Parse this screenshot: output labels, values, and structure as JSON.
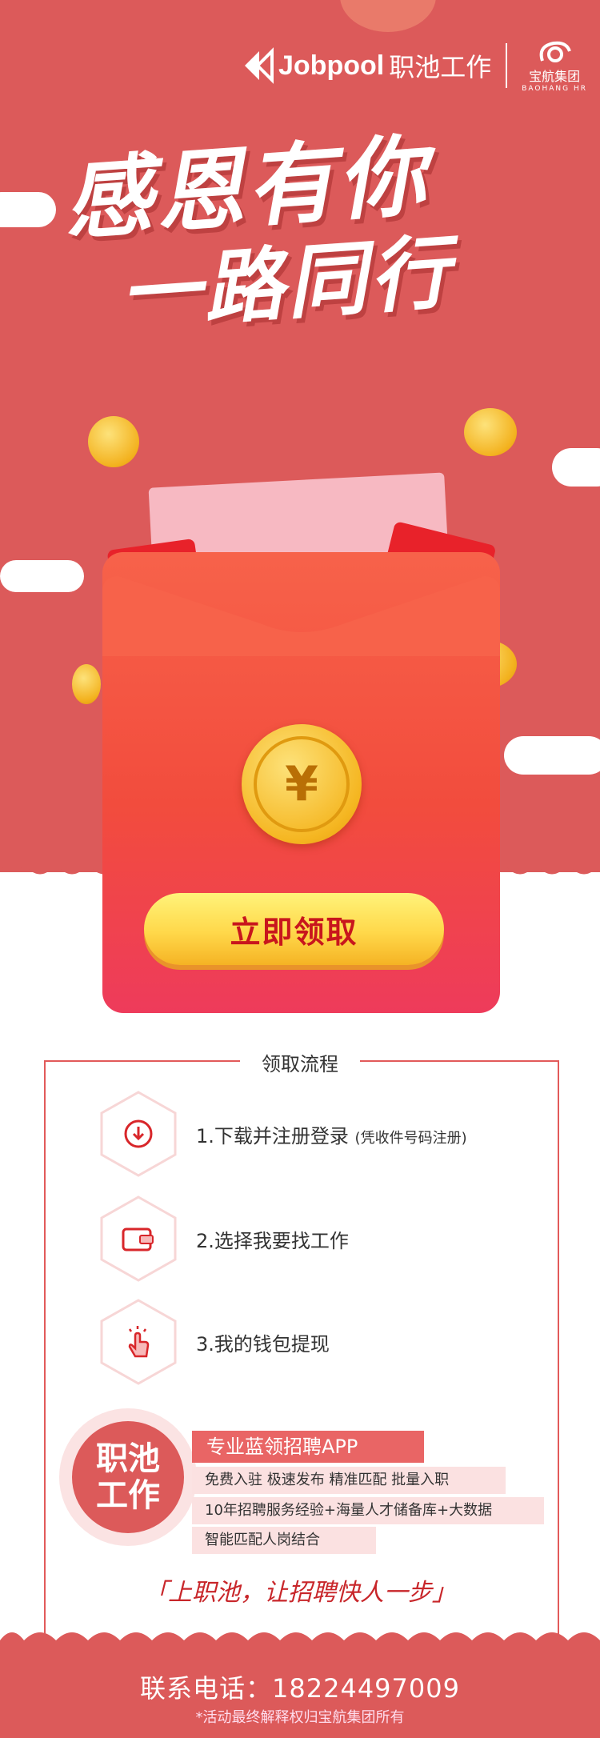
{
  "brand": {
    "jobpool_en": "Jobpool",
    "jobpool_cn": "职池工作",
    "group_name": "宝航集团",
    "group_en": "BAOHANG HR"
  },
  "hero": {
    "line1": "感恩有你",
    "line2": "一路同行"
  },
  "envelope": {
    "coin_symbol": "¥",
    "claim_button": "立即领取"
  },
  "process": {
    "title": "领取流程",
    "steps": [
      {
        "label": "1.下载并注册登录",
        "note": "(凭收件号码注册)",
        "icon": "download-icon"
      },
      {
        "label": "2.选择我要找工作",
        "note": "",
        "icon": "wallet-icon"
      },
      {
        "label": "3.我的钱包提现",
        "note": "",
        "icon": "tap-hand-icon"
      }
    ]
  },
  "promo": {
    "badge": "职池工作",
    "headline": "专业蓝领招聘APP",
    "tags": [
      "免费入驻 极速发布 精准匹配 批量入职",
      "10年招聘服务经验+海量人才储备库+大数据",
      "智能匹配人岗结合"
    ],
    "slogan": "「上职池，让招聘快人一步」"
  },
  "footer": {
    "phone": "联系电话：18224497009",
    "note": "*活动最终解释权归宝航集团所有"
  },
  "colors": {
    "primary": "#dc5a5a",
    "accent_red": "#c8161d",
    "gold": "#f5b621"
  }
}
